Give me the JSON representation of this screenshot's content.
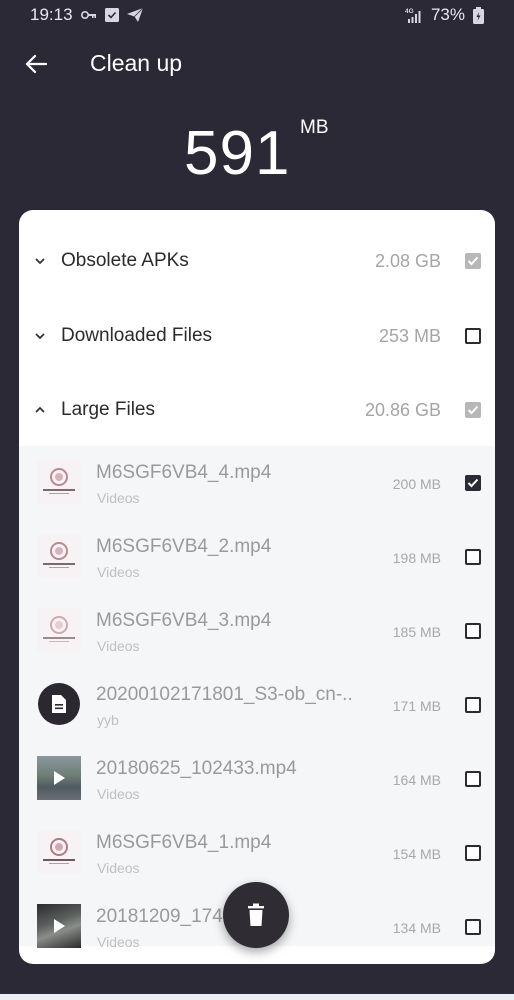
{
  "status_bar": {
    "time": "19:13",
    "left_icons": [
      "vpn-key-icon",
      "task-check-icon",
      "telegram-send-icon"
    ],
    "network": "4G",
    "battery": "73%"
  },
  "app_bar": {
    "back_icon": "arrow-left-icon",
    "title": "Clean up"
  },
  "total": {
    "value": "591",
    "unit": "MB"
  },
  "categories": [
    {
      "label": "Obsolete APKs",
      "size": "2.08 GB",
      "expanded": false,
      "checked": true,
      "check_style": "grey"
    },
    {
      "label": "Downloaded Files",
      "size": "253 MB",
      "expanded": false,
      "checked": false,
      "check_style": "none"
    },
    {
      "label": "Large Files",
      "size": "20.86 GB",
      "expanded": true,
      "checked": true,
      "check_style": "grey"
    }
  ],
  "large_files": [
    {
      "name": "M6SGF6VB4_4.mp4",
      "sub": "Videos",
      "size": "200 MB",
      "checked": true,
      "thumb": "logo"
    },
    {
      "name": "M6SGF6VB4_2.mp4",
      "sub": "Videos",
      "size": "198 MB",
      "checked": false,
      "thumb": "logo"
    },
    {
      "name": "M6SGF6VB4_3.mp4",
      "sub": "Videos",
      "size": "185 MB",
      "checked": false,
      "thumb": "logo"
    },
    {
      "name": "20200102171801_S3-ob_cn-..",
      "sub": "yyb",
      "size": "171 MB",
      "checked": false,
      "thumb": "doc"
    },
    {
      "name": "20180625_102433.mp4",
      "sub": "Videos",
      "size": "164 MB",
      "checked": false,
      "thumb": "video1"
    },
    {
      "name": "M6SGF6VB4_1.mp4",
      "sub": "Videos",
      "size": "154 MB",
      "checked": false,
      "thumb": "logo"
    },
    {
      "name": "20181209_174….mp4",
      "sub": "Videos",
      "size": "134 MB",
      "checked": false,
      "thumb": "video2"
    }
  ],
  "fab": {
    "icon": "trash-icon",
    "label": "Delete"
  },
  "colors": {
    "background": "#2c2936",
    "card": "#ffffff",
    "files_panel": "#f4f6f8",
    "checked_dark": "#2b2b35",
    "checked_grey": "#b7b7b7",
    "fab": "#2f2c33"
  }
}
